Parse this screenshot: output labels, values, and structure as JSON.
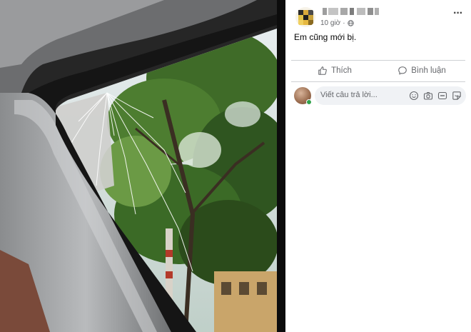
{
  "post": {
    "timestamp": "10 giờ",
    "text": "Em cũng mới bị."
  },
  "actions": {
    "like_label": "Thích",
    "comment_label": "Bình luận"
  },
  "comment": {
    "placeholder": "Viết câu trả lời..."
  },
  "icons": {
    "more": "more-options-icon",
    "visibility": "globe-icon",
    "like": "thumbs-up-icon",
    "comment": "speech-bubble-icon",
    "emoji": "emoji-icon",
    "camera": "camera-icon",
    "gif": "gif-icon",
    "sticker": "sticker-icon"
  },
  "colors": {
    "online": "#31a24c",
    "secondary_text": "#65676b",
    "input_bg": "#f0f2f5"
  }
}
